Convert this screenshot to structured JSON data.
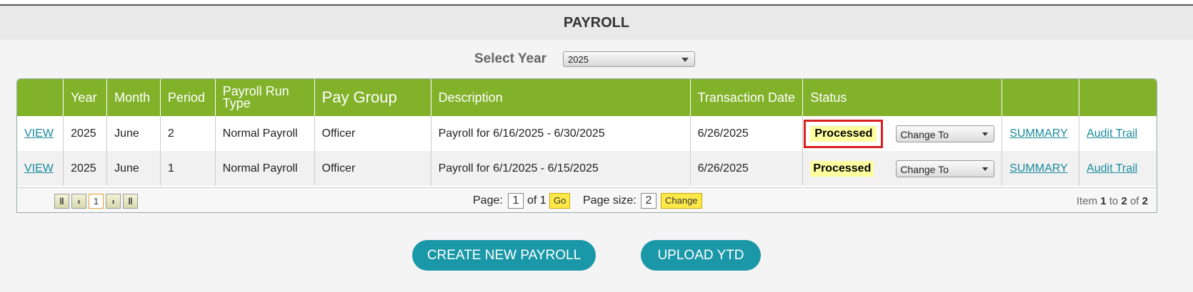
{
  "page": {
    "title": "PAYROLL"
  },
  "year_filter": {
    "label": "Select Year",
    "selected": "2025"
  },
  "table": {
    "columns": [
      "",
      "Year",
      "Month",
      "Period",
      "Payroll Run Type",
      "Pay Group",
      "Description",
      "Transaction Date",
      "Status",
      "",
      ""
    ],
    "rows": [
      {
        "view": "VIEW",
        "year": "2025",
        "month": "June",
        "period": "2",
        "run_type": "Normal Payroll",
        "pay_group": "Officer",
        "description": "Payroll for 6/16/2025 - 6/30/2025",
        "transaction_date": "6/26/2025",
        "status": "Processed",
        "change_to": "Change To",
        "summary": "SUMMARY",
        "audit": "Audit Trail"
      },
      {
        "view": "VIEW",
        "year": "2025",
        "month": "June",
        "period": "1",
        "run_type": "Normal Payroll",
        "pay_group": "Officer",
        "description": "Payroll for 6/1/2025 - 6/15/2025",
        "transaction_date": "6/26/2025",
        "status": "Processed",
        "change_to": "Change To",
        "summary": "SUMMARY",
        "audit": "Audit Trail"
      }
    ]
  },
  "pager": {
    "first_icon": "first-page-icon",
    "prev_icon": "prev-page-icon",
    "next_icon": "next-page-icon",
    "last_icon": "last-page-icon",
    "current_page_button": "1",
    "page_label": "Page:",
    "page_value": "1",
    "of_text": "of 1",
    "go_label": "Go",
    "page_size_label": "Page size:",
    "page_size_value": "2",
    "change_label": "Change",
    "item_prefix": "Item",
    "item_from": "1",
    "item_to_word": "to",
    "item_to": "2",
    "item_of_word": "of",
    "item_total": "2"
  },
  "actions": {
    "create": "CREATE NEW PAYROLL",
    "upload": "UPLOAD YTD"
  },
  "colors": {
    "header_green": "#82b12a",
    "accent_teal": "#1a98a8",
    "highlight": "#ffffa0",
    "alert_red": "#d92020"
  }
}
